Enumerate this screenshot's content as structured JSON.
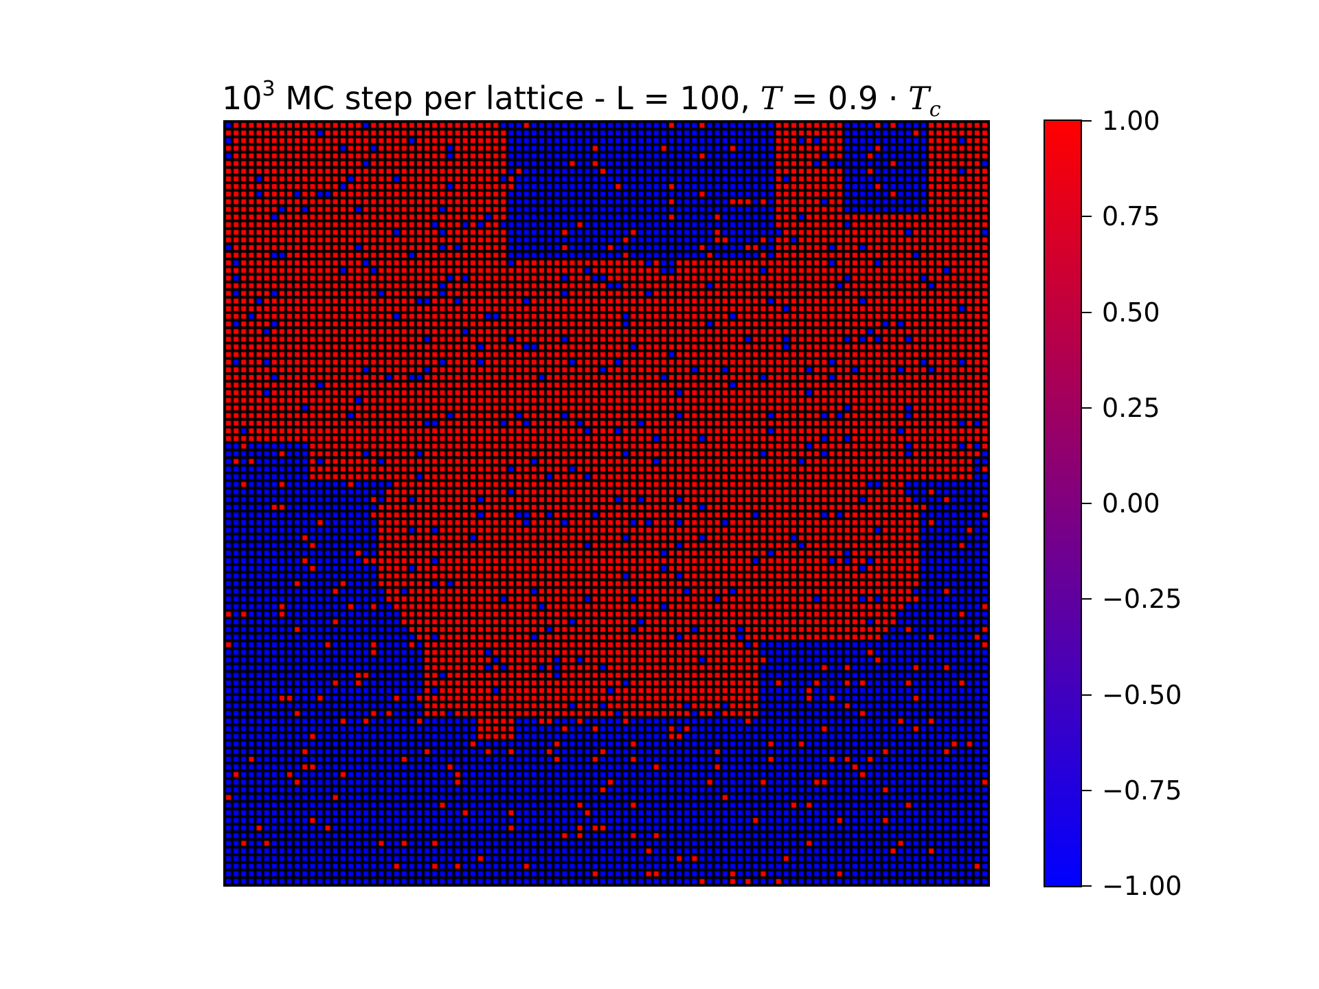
{
  "chart_data": {
    "type": "heatmap",
    "title_parts": {
      "base": "10",
      "exponent": "3",
      "text": " MC step per lattice - L = 100, ",
      "temp_symbol": "T",
      "temp_relation": " = 0.9 · ",
      "tc_symbol": "T",
      "tc_subscript": "c"
    },
    "lattice_size": 100,
    "values": [
      -1,
      1
    ],
    "colormap": {
      "low": "#0000ff",
      "mid": "#800080",
      "high": "#ff0000",
      "cell_border": "#000000"
    },
    "colorbar": {
      "range": [
        -1.0,
        1.0
      ],
      "ticks": [
        1.0,
        0.75,
        0.5,
        0.25,
        0.0,
        -0.25,
        -0.5,
        -0.75,
        -1.0
      ],
      "tick_labels": [
        "1.00",
        "0.75",
        "0.50",
        "0.25",
        "0.00",
        "−0.25",
        "−0.50",
        "−0.75",
        "−1.00"
      ]
    },
    "axes_visible": false
  }
}
